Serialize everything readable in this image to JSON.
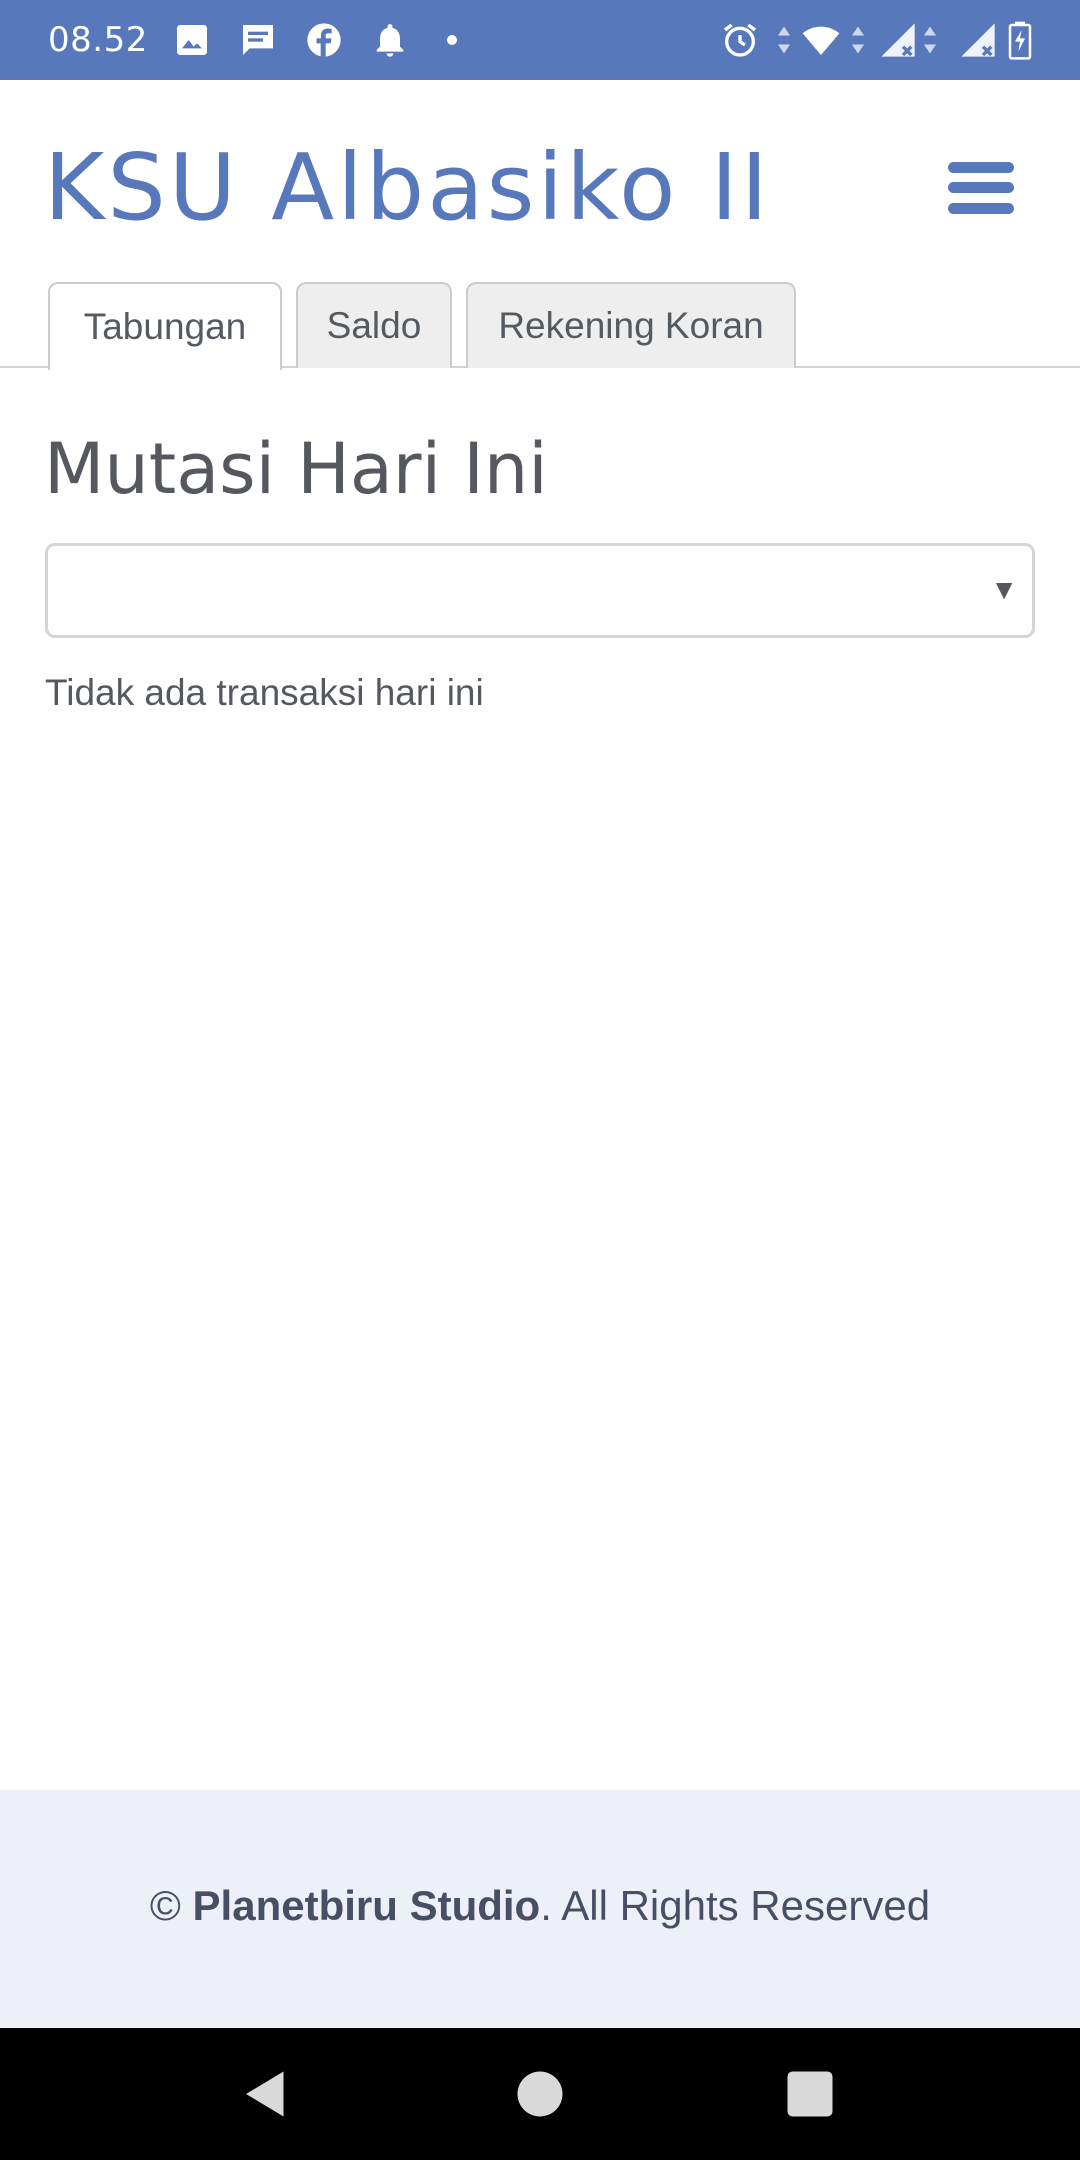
{
  "status_bar": {
    "time": "08.52",
    "icons": [
      "image-icon",
      "message-icon",
      "facebook-icon",
      "bell-icon",
      "dot-icon",
      "alarm-icon",
      "wifi-icon",
      "signal-icon",
      "signal-icon",
      "battery-charging-icon"
    ]
  },
  "header": {
    "title": "KSU Albasiko II",
    "menu_icon": "hamburger-menu-icon"
  },
  "tabs": [
    {
      "label": "Tabungan",
      "active": true
    },
    {
      "label": "Saldo",
      "active": false
    },
    {
      "label": "Rekening Koran",
      "active": false
    }
  ],
  "main": {
    "title": "Mutasi Hari Ini",
    "select_value": "",
    "select_caret": "▼",
    "empty_message": "Tidak ada transaksi hari ini"
  },
  "footer": {
    "copyright_symbol": "©",
    "company": "Planetbiru Studio",
    "suffix": ". All Rights Reserved"
  },
  "nav_bar": {
    "icons": [
      "back-icon",
      "home-icon",
      "recents-icon"
    ]
  },
  "colors": {
    "brand": "#5878bc",
    "footer_bg": "#edf0f7",
    "text": "#55595f"
  }
}
